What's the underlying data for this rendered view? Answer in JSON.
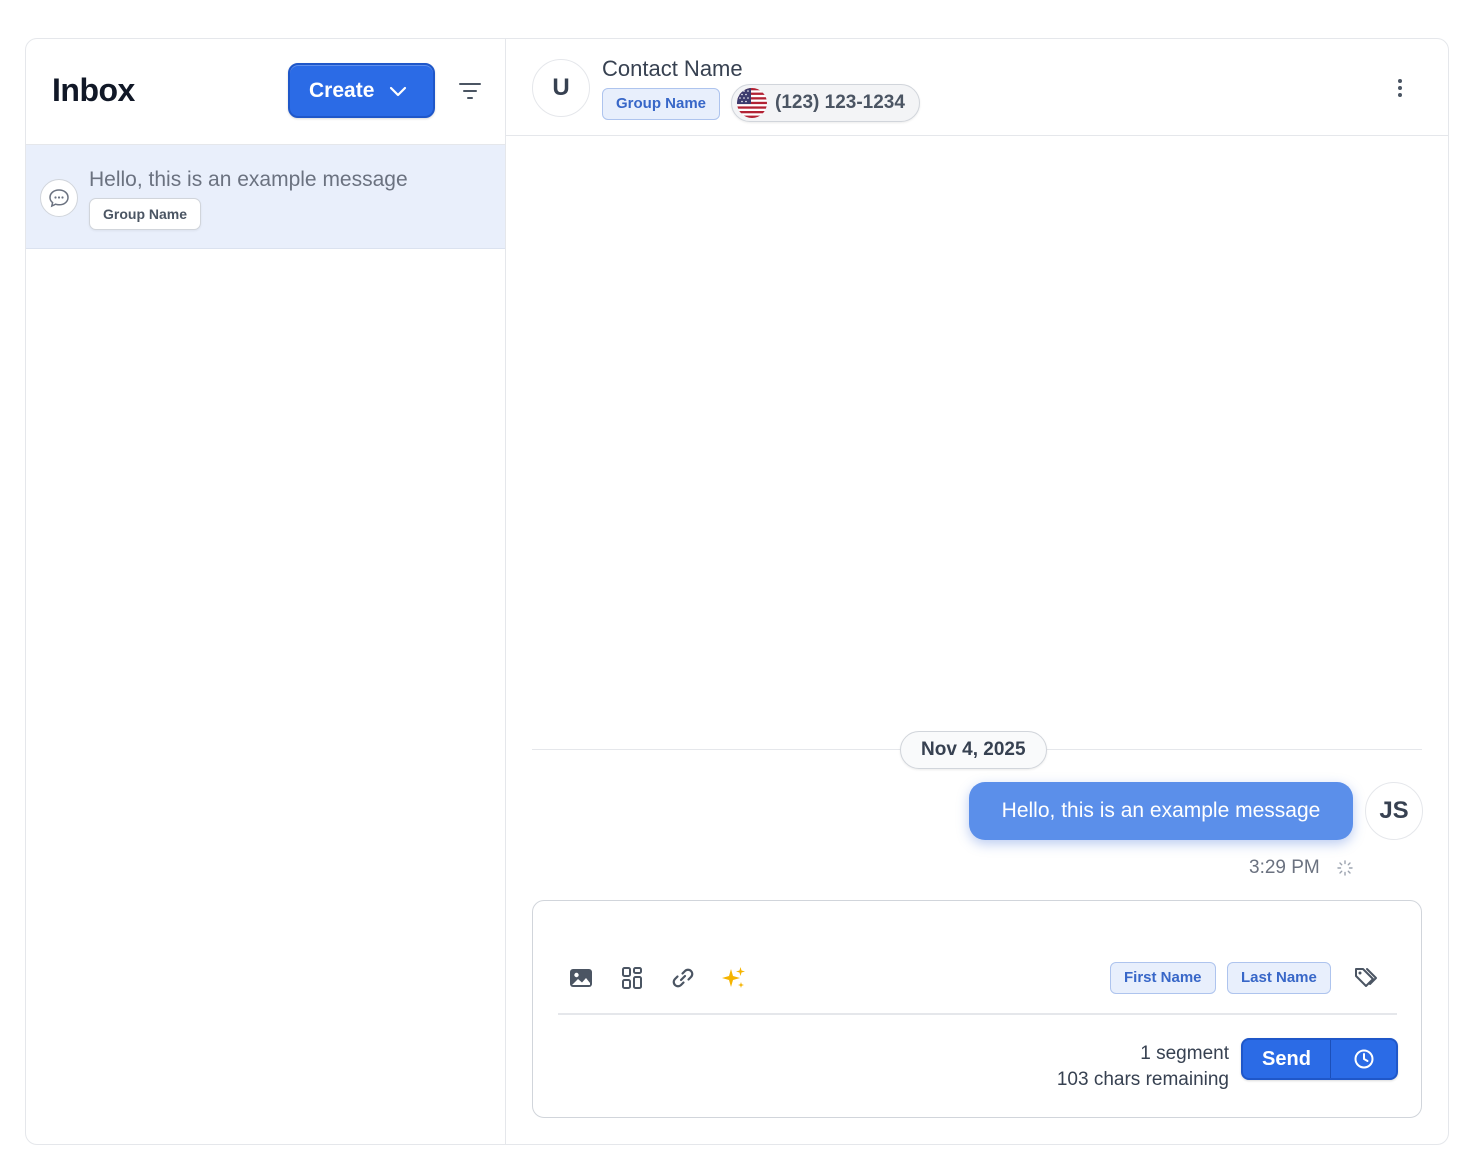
{
  "sidebar": {
    "title": "Inbox",
    "create_label": "Create",
    "conversations": [
      {
        "preview": "Hello, this is an example message",
        "tag": "Group Name"
      }
    ]
  },
  "contact": {
    "avatar_initial": "U",
    "name": "Contact Name",
    "group": "Group Name",
    "phone": "(123) 123-1234",
    "flag_icon": "us-flag-icon"
  },
  "thread": {
    "date": "Nov 4, 2025",
    "messages": [
      {
        "text": "Hello, this is an example message",
        "sender_initials": "JS",
        "time": "3:29 PM",
        "status_icon": "pending-spinner-icon"
      }
    ]
  },
  "composer": {
    "tools": [
      "image-icon",
      "template-icon",
      "link-icon",
      "ai-sparkle-icon"
    ],
    "variables": [
      "First Name",
      "Last Name"
    ],
    "segment_text": "1 segment",
    "chars_remaining_text": "103 chars remaining",
    "send_label": "Send"
  },
  "colors": {
    "primary": "#2b6be6",
    "bubble": "#5b8fea",
    "selected_row": "#e9effb",
    "tag_bg": "#e8effc",
    "tag_text": "#3867c8",
    "sparkle": "#f5b400"
  }
}
